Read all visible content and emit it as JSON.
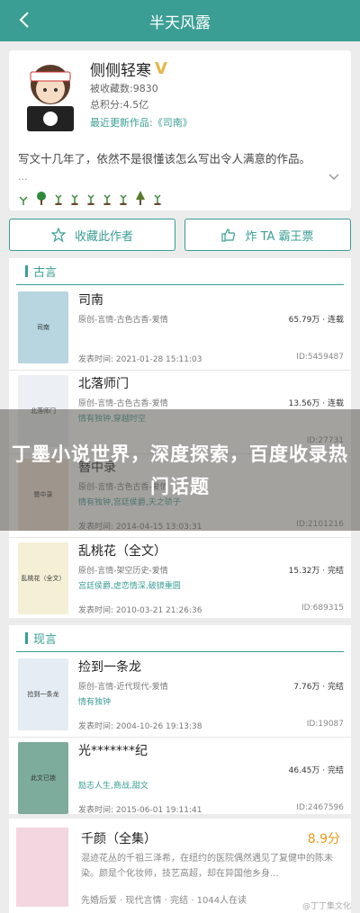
{
  "header": {
    "title": "半天风露"
  },
  "author": {
    "name": "侧侧轻寒",
    "bookmarks": "被收藏数:9830",
    "points": "总积分:4.5亿",
    "latest_prefix": "最近更新作品:",
    "latest_work": "《司南》",
    "bio": "写文十几年了，依然不是很懂该怎么写出令人满意的作品。",
    "bio_more": "..."
  },
  "actions": {
    "favorite": "收藏此作者",
    "bawang": "炸 TA 霸王票"
  },
  "sections": [
    {
      "title": "古言",
      "books": [
        {
          "title": "司南",
          "category": "原创-言情-古色古香-爱情",
          "words": "65.79万 · 连载",
          "tags": "",
          "date": "发表时间: 2021-01-28 15:11:03",
          "id": "ID:5459487",
          "cover_text": "司南",
          "cover_color": "#b7d6df"
        },
        {
          "title": "北落师门",
          "category": "原创-言情-古色古香-爱情",
          "words": "13.56万 · 连载",
          "tags": "情有独钟,穿越时空",
          "date": "",
          "id": "ID:27731",
          "cover_text": "北落师门",
          "cover_color": "#eceff3"
        },
        {
          "title": "簪中录",
          "category": "原创-言情-古色古香-爱情",
          "words": "",
          "tags": "情有独钟,宫廷侯爵,天之骄子",
          "date": "发表时间: 2014-04-15 13:03:31",
          "id": "ID:2101216",
          "cover_text": "簪中录",
          "cover_color": "#f2e3d6"
        },
        {
          "title": "乱桃花（全文）",
          "category": "原创-言情-架空历史-爱情",
          "words": "15.32万 · 完结",
          "tags": "宫廷侯爵,虐恋情深,破镜重圆",
          "date": "发表时间: 2010-03-21 21:26:36",
          "id": "ID:689315",
          "cover_text": "乱桃花（全文）",
          "cover_color": "#f4f0d6"
        }
      ]
    },
    {
      "title": "现言",
      "books": [
        {
          "title": "捡到一条龙",
          "category": "原创-言情-近代现代-爱情",
          "words": "7.76万 · 完结",
          "tags": "情有独钟",
          "date": "发表时间: 2004-10-26 19:13:38",
          "id": "ID:19087",
          "cover_text": "捡到一条龙",
          "cover_color": "#e5ecf3"
        },
        {
          "title": "光*******纪",
          "category": "",
          "words": "46.45万 · 完结",
          "tags": "励志人生,商战,甜文",
          "date": "发表时间: 2015-06-01 19:11:41",
          "id": "ID:2467596",
          "cover_text": "此文已锁",
          "cover_color": "#7dab9c"
        }
      ]
    }
  ],
  "overlay": {
    "text": "丁墨小说世界，深度探索，百度收录热门话题"
  },
  "bottom_book": {
    "title": "千颜（全集）",
    "score": "8.9分",
    "desc": "混迹花丛的千祖三泽希，在纽约的医院偶然遇见了复健中的陈未染。颜是个化妆师，技艺高超，却在异国他乡身...",
    "meta": "先婚后爱 · 现代言情 · 完结 · 1044人在读"
  },
  "watermark": "@丁丁集文化",
  "colors": {
    "accent": "#3a9e94",
    "vip": "#e7b64a",
    "score": "#e59a1a"
  }
}
